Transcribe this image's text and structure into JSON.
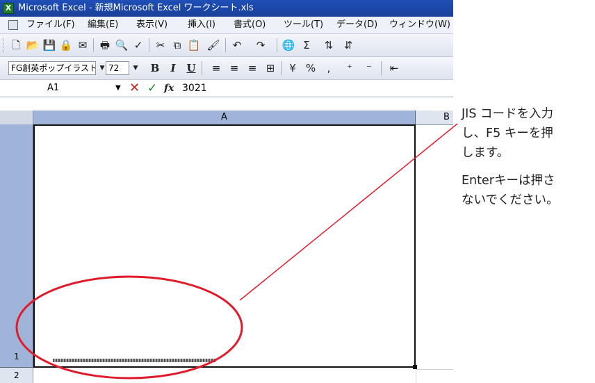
{
  "window": {
    "title": "Microsoft Excel - 新規Microsoft Excel ワークシート.xls",
    "app_icon": "excel-icon"
  },
  "menu": {
    "items": [
      "ファイル(F)",
      "編集(E)",
      "表示(V)",
      "挿入(I)",
      "書式(O)",
      "ツール(T)",
      "データ(D)",
      "ウィンドウ(W)"
    ]
  },
  "standard_toolbar": {
    "icons": [
      "new-icon",
      "open-icon",
      "save-icon",
      "permission-icon",
      "email-icon",
      "print-icon",
      "print-preview-icon",
      "spelling-icon",
      "cut-icon",
      "copy-icon",
      "paste-icon",
      "format-painter-icon",
      "undo-icon",
      "redo-icon",
      "hyperlink-icon",
      "autosum-icon",
      "sort-ascending-icon",
      "sort-descending-icon"
    ]
  },
  "formatting_toolbar": {
    "font_name": "FG創英ポップイラスト",
    "font_size": "72",
    "bold": "B",
    "italic": "I",
    "underline": "U"
  },
  "formula_bar": {
    "name_box": "A1",
    "fx_label": "fx",
    "value": "3021"
  },
  "sheet": {
    "column_a": "A",
    "column_b": "B",
    "row_1": "1",
    "row_2": "2"
  },
  "annotation": {
    "lines_1": [
      "JIS コードを入力",
      "し、F5 キーを押",
      "します。"
    ],
    "lines_2": [
      "Enterキーは押さ",
      "ないでください。"
    ],
    "colors": {
      "highlight": "#e01c2c"
    }
  }
}
